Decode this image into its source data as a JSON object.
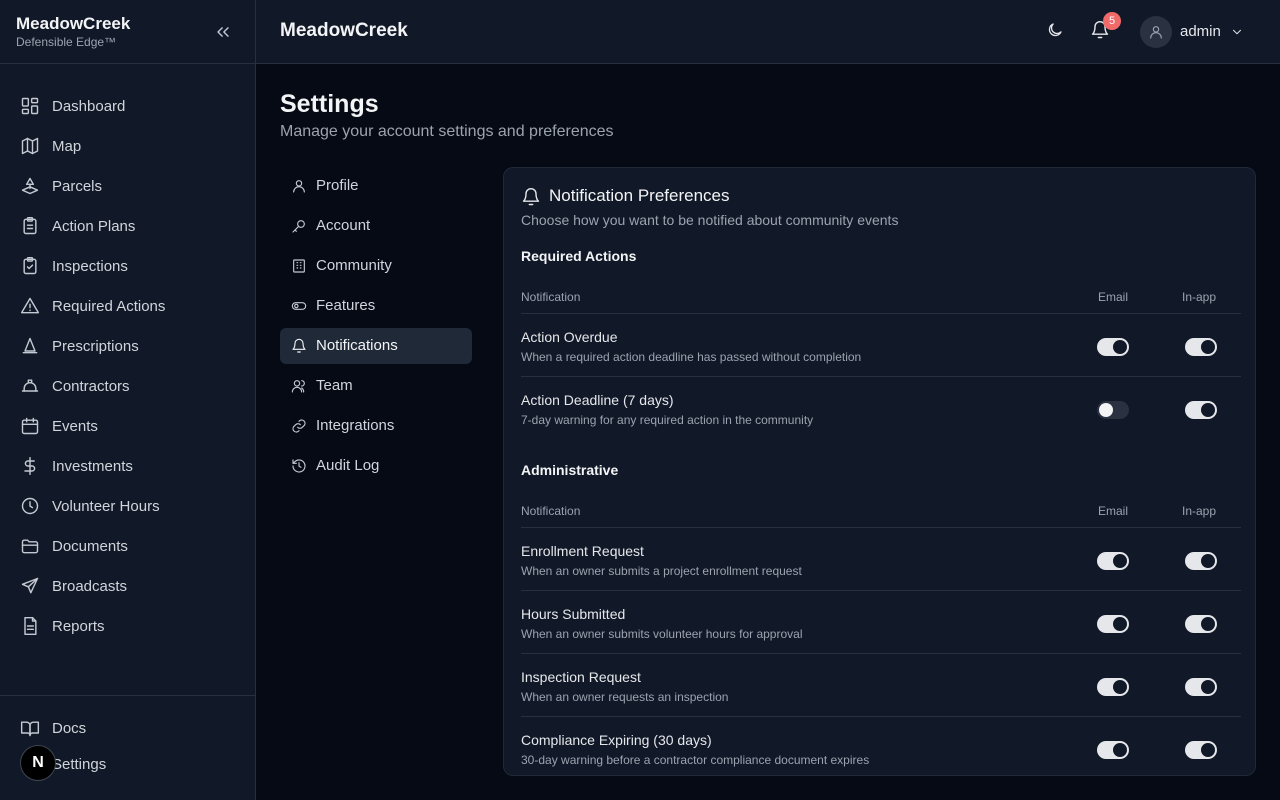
{
  "brand": {
    "name": "MeadowCreek",
    "tagline": "Defensible Edge™"
  },
  "sidebar": {
    "items": [
      {
        "label": "Dashboard",
        "icon": "dashboard-icon"
      },
      {
        "label": "Map",
        "icon": "map-icon"
      },
      {
        "label": "Parcels",
        "icon": "parcels-icon"
      },
      {
        "label": "Action Plans",
        "icon": "clipboard-list-icon"
      },
      {
        "label": "Inspections",
        "icon": "clipboard-check-icon"
      },
      {
        "label": "Required Actions",
        "icon": "warning-icon"
      },
      {
        "label": "Prescriptions",
        "icon": "cone-icon"
      },
      {
        "label": "Contractors",
        "icon": "hard-hat-icon"
      },
      {
        "label": "Events",
        "icon": "calendar-icon"
      },
      {
        "label": "Investments",
        "icon": "dollar-icon"
      },
      {
        "label": "Volunteer Hours",
        "icon": "clock-icon"
      },
      {
        "label": "Documents",
        "icon": "folder-icon"
      },
      {
        "label": "Broadcasts",
        "icon": "send-icon"
      },
      {
        "label": "Reports",
        "icon": "report-icon"
      }
    ],
    "bottom": [
      {
        "label": "Docs",
        "icon": "book-icon"
      },
      {
        "label": "Settings",
        "icon": "settings-icon"
      }
    ],
    "badge": "N"
  },
  "topbar": {
    "title": "MeadowCreek",
    "notification_count": "5",
    "user": "admin"
  },
  "page": {
    "title": "Settings",
    "subtitle": "Manage your account settings and preferences"
  },
  "settings_nav": [
    {
      "label": "Profile",
      "icon": "user-icon",
      "active": false
    },
    {
      "label": "Account",
      "icon": "key-icon",
      "active": false
    },
    {
      "label": "Community",
      "icon": "building-icon",
      "active": false
    },
    {
      "label": "Features",
      "icon": "toggle-icon",
      "active": false
    },
    {
      "label": "Notifications",
      "icon": "bell-icon",
      "active": true
    },
    {
      "label": "Team",
      "icon": "users-icon",
      "active": false
    },
    {
      "label": "Integrations",
      "icon": "link-icon",
      "active": false
    },
    {
      "label": "Audit Log",
      "icon": "history-icon",
      "active": false
    }
  ],
  "card": {
    "title": "Notification Preferences",
    "subtitle": "Choose how you want to be notified about community events",
    "columns": {
      "notification": "Notification",
      "email": "Email",
      "inapp": "In-app"
    },
    "sections": [
      {
        "title": "Required Actions",
        "rows": [
          {
            "title": "Action Overdue",
            "desc": "When a required action deadline has passed without completion",
            "email": true,
            "inapp": true
          },
          {
            "title": "Action Deadline (7 days)",
            "desc": "7-day warning for any required action in the community",
            "email": false,
            "inapp": true
          }
        ]
      },
      {
        "title": "Administrative",
        "rows": [
          {
            "title": "Enrollment Request",
            "desc": "When an owner submits a project enrollment request",
            "email": true,
            "inapp": true
          },
          {
            "title": "Hours Submitted",
            "desc": "When an owner submits volunteer hours for approval",
            "email": true,
            "inapp": true
          },
          {
            "title": "Inspection Request",
            "desc": "When an owner requests an inspection",
            "email": true,
            "inapp": true
          },
          {
            "title": "Compliance Expiring (30 days)",
            "desc": "30-day warning before a contractor compliance document expires",
            "email": true,
            "inapp": true
          }
        ]
      }
    ]
  }
}
